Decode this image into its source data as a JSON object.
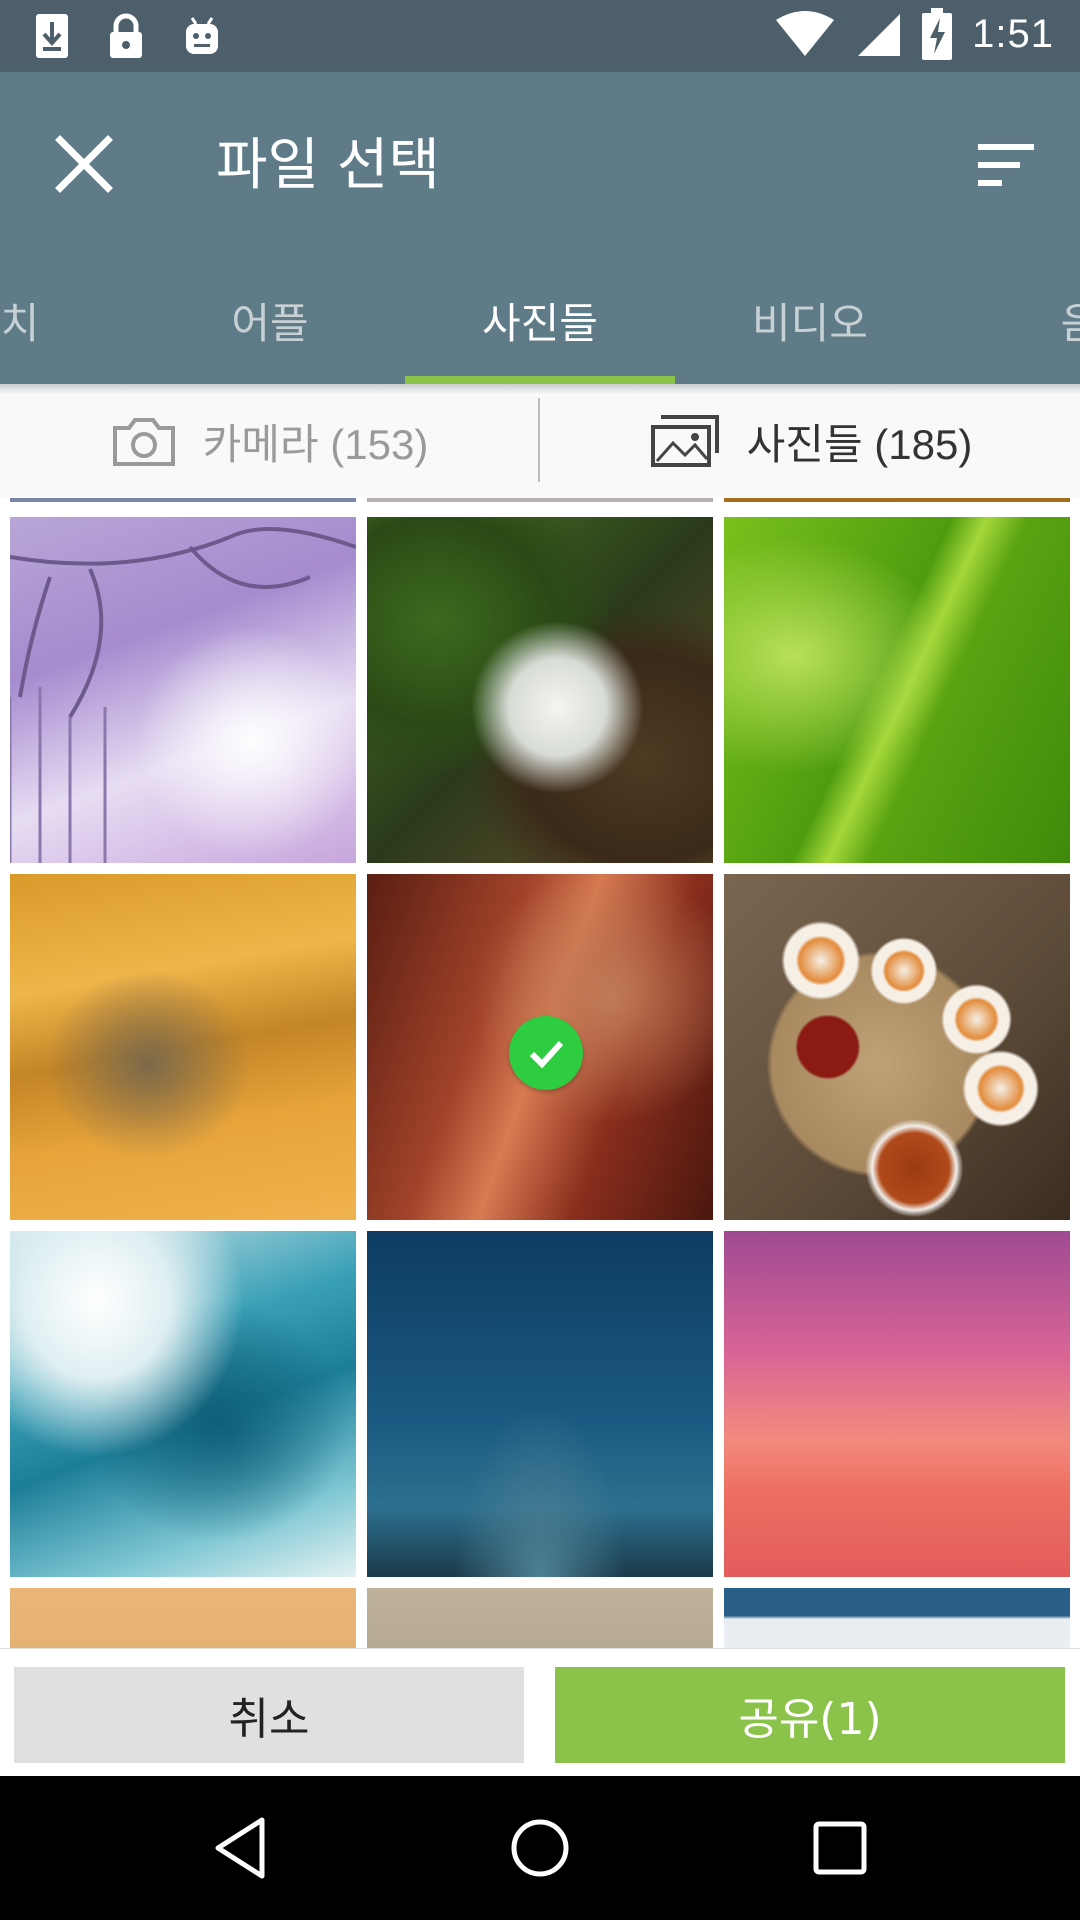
{
  "status_bar": {
    "time": "1:51",
    "left_icons": [
      "download-icon",
      "lock-icon",
      "android-icon"
    ],
    "right_icons": [
      "wifi-icon",
      "signal-icon",
      "battery-charging-icon"
    ]
  },
  "app_bar": {
    "title": "파일 선택",
    "close_icon": "close-icon",
    "sort_icon": "sort-icon",
    "background": "#5f7b87"
  },
  "tabs": [
    {
      "label": "치"
    },
    {
      "label": "어플"
    },
    {
      "label": "사진들",
      "selected": true
    },
    {
      "label": "비디오"
    },
    {
      "label": "음"
    }
  ],
  "sub_tabs": {
    "camera": {
      "label": "카메라 (153)",
      "icon": "camera-icon"
    },
    "photos": {
      "label": "사진들 (185)",
      "icon": "photos-icon",
      "selected": true
    }
  },
  "grid": {
    "thumbnails": [
      {
        "name": "snowy-branches",
        "selected": false
      },
      {
        "name": "mossy-waterfall",
        "selected": false
      },
      {
        "name": "green-leaf-drops",
        "selected": false
      },
      {
        "name": "desert-dunes",
        "selected": false
      },
      {
        "name": "red-canyon",
        "selected": true
      },
      {
        "name": "tea-set",
        "selected": false
      },
      {
        "name": "ocean-wave",
        "selected": false
      },
      {
        "name": "starry-night",
        "selected": false
      },
      {
        "name": "pink-sunset",
        "selected": false
      }
    ]
  },
  "actions": {
    "cancel_label": "취소",
    "share_label": "공유(1)",
    "accent": "#8bc34a"
  },
  "nav_bar": {
    "icons": [
      "back-icon",
      "home-icon",
      "recents-icon"
    ]
  }
}
